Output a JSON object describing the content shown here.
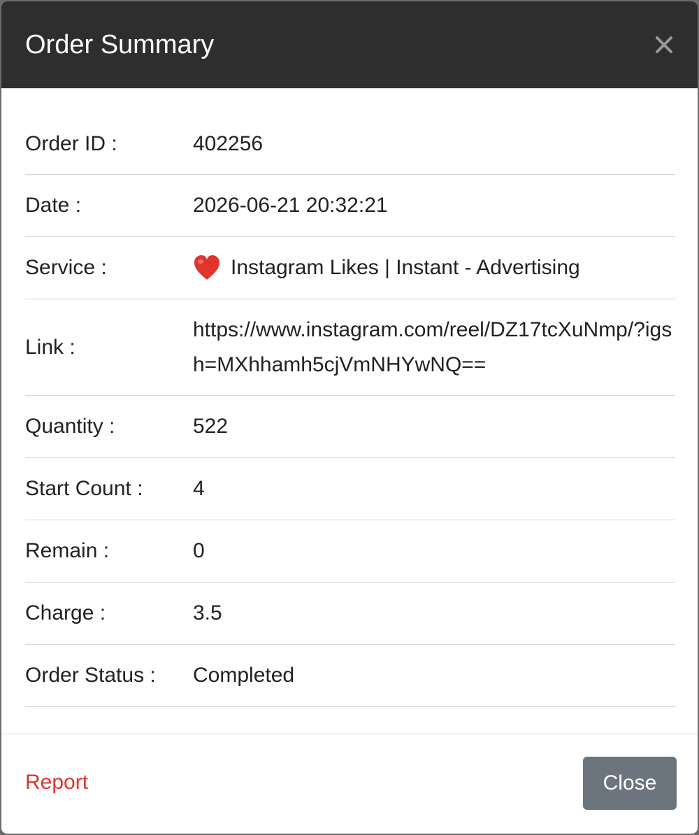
{
  "modal": {
    "title": "Order Summary",
    "close_icon": "close-icon"
  },
  "details": [
    {
      "label": "Order ID :",
      "value": "402256"
    },
    {
      "label": "Date :",
      "value": "2026-06-21 20:32:21"
    },
    {
      "label": "Service :",
      "value": "Instagram Likes | Instant - Advertising",
      "icon": "heart-icon"
    },
    {
      "label": "Link :",
      "value": "https://www.instagram.com/reel/DZ17tcXuNmp/?igsh=MXhhamh5cjVmNHYwNQ=="
    },
    {
      "label": "Quantity :",
      "value": "522"
    },
    {
      "label": "Start Count :",
      "value": "4"
    },
    {
      "label": "Remain :",
      "value": "0"
    },
    {
      "label": "Charge :",
      "value": "3.5"
    },
    {
      "label": "Order Status :",
      "value": "Completed"
    }
  ],
  "footer": {
    "report_label": "Report",
    "close_label": "Close"
  },
  "colors": {
    "header_bg": "#2e2e2e",
    "report_link": "#e0342c",
    "close_button": "#6c757d",
    "heart": "#e0342c"
  }
}
